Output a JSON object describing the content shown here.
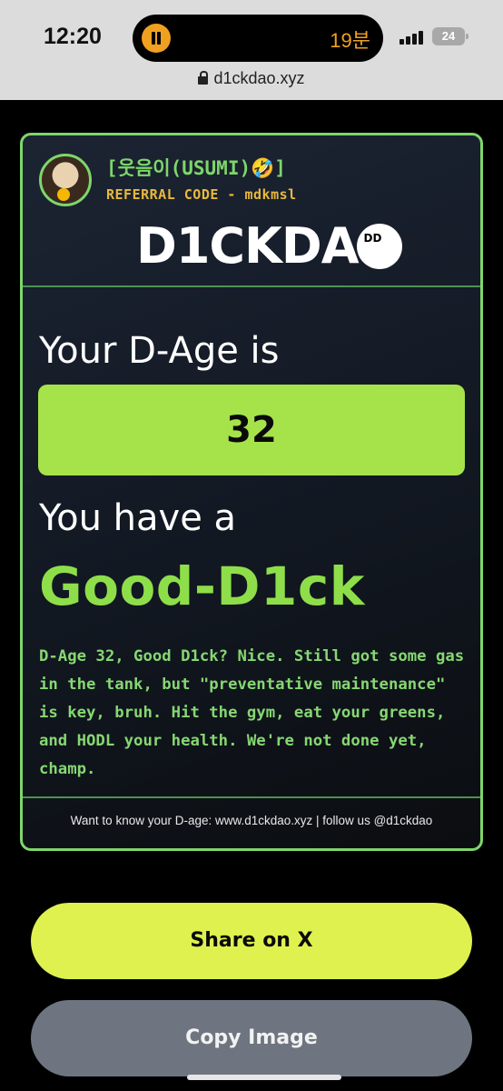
{
  "status_bar": {
    "time": "12:20",
    "timer": "19분",
    "battery": "24"
  },
  "browser": {
    "url": "d1ckdao.xyz"
  },
  "card": {
    "username": "[웃음이(USUMI)🤣]",
    "referral": "REFERRAL CODE - mdkmsl",
    "logo_text": "D1CKDA",
    "logo_badge": "DD",
    "age_heading": "Your D-Age is",
    "age_value": "32",
    "have_heading": "You have a",
    "result": "Good-D1ck",
    "description": "D-Age 32, Good D1ck? Nice. Still got some gas in the tank, but \"preventative maintenance\" is key, bruh. Hit the gym, eat your greens, and HODL your health. We're not done yet, champ.",
    "footer": "Want to know your D-age: www.d1ckdao.xyz | follow us @d1ckdao"
  },
  "buttons": {
    "share": "Share on X",
    "copy": "Copy Image"
  },
  "colors": {
    "accent_green": "#7ed66b",
    "result_green": "#8ede4a",
    "age_box": "#a6e34a",
    "share_button": "#dff14f",
    "copy_button": "#6e7580"
  },
  "icons": [
    "pause-icon",
    "signal-icon",
    "battery-icon",
    "lock-icon"
  ]
}
